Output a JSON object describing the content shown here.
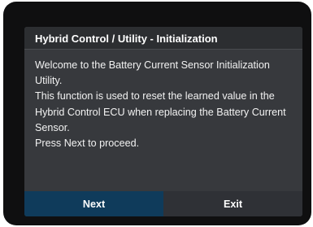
{
  "dialog": {
    "title": "Hybrid Control / Utility - Initialization",
    "lines": [
      "Welcome to the Battery Current Sensor Initialization Utility.",
      "This function is used to reset the learned value in the Hybrid Control ECU when replacing the Battery Current Sensor.",
      "Press Next to proceed."
    ],
    "buttons": {
      "next_label": "Next",
      "exit_label": "Exit"
    }
  },
  "colors": {
    "screen_bg": "#0f0f10",
    "dialog_bg": "#37393d",
    "title_bg": "#2c2e31",
    "next_button_bg": "#0f3b5b",
    "exit_button_bg": "#2f3136",
    "text": "#f2f2f2"
  }
}
